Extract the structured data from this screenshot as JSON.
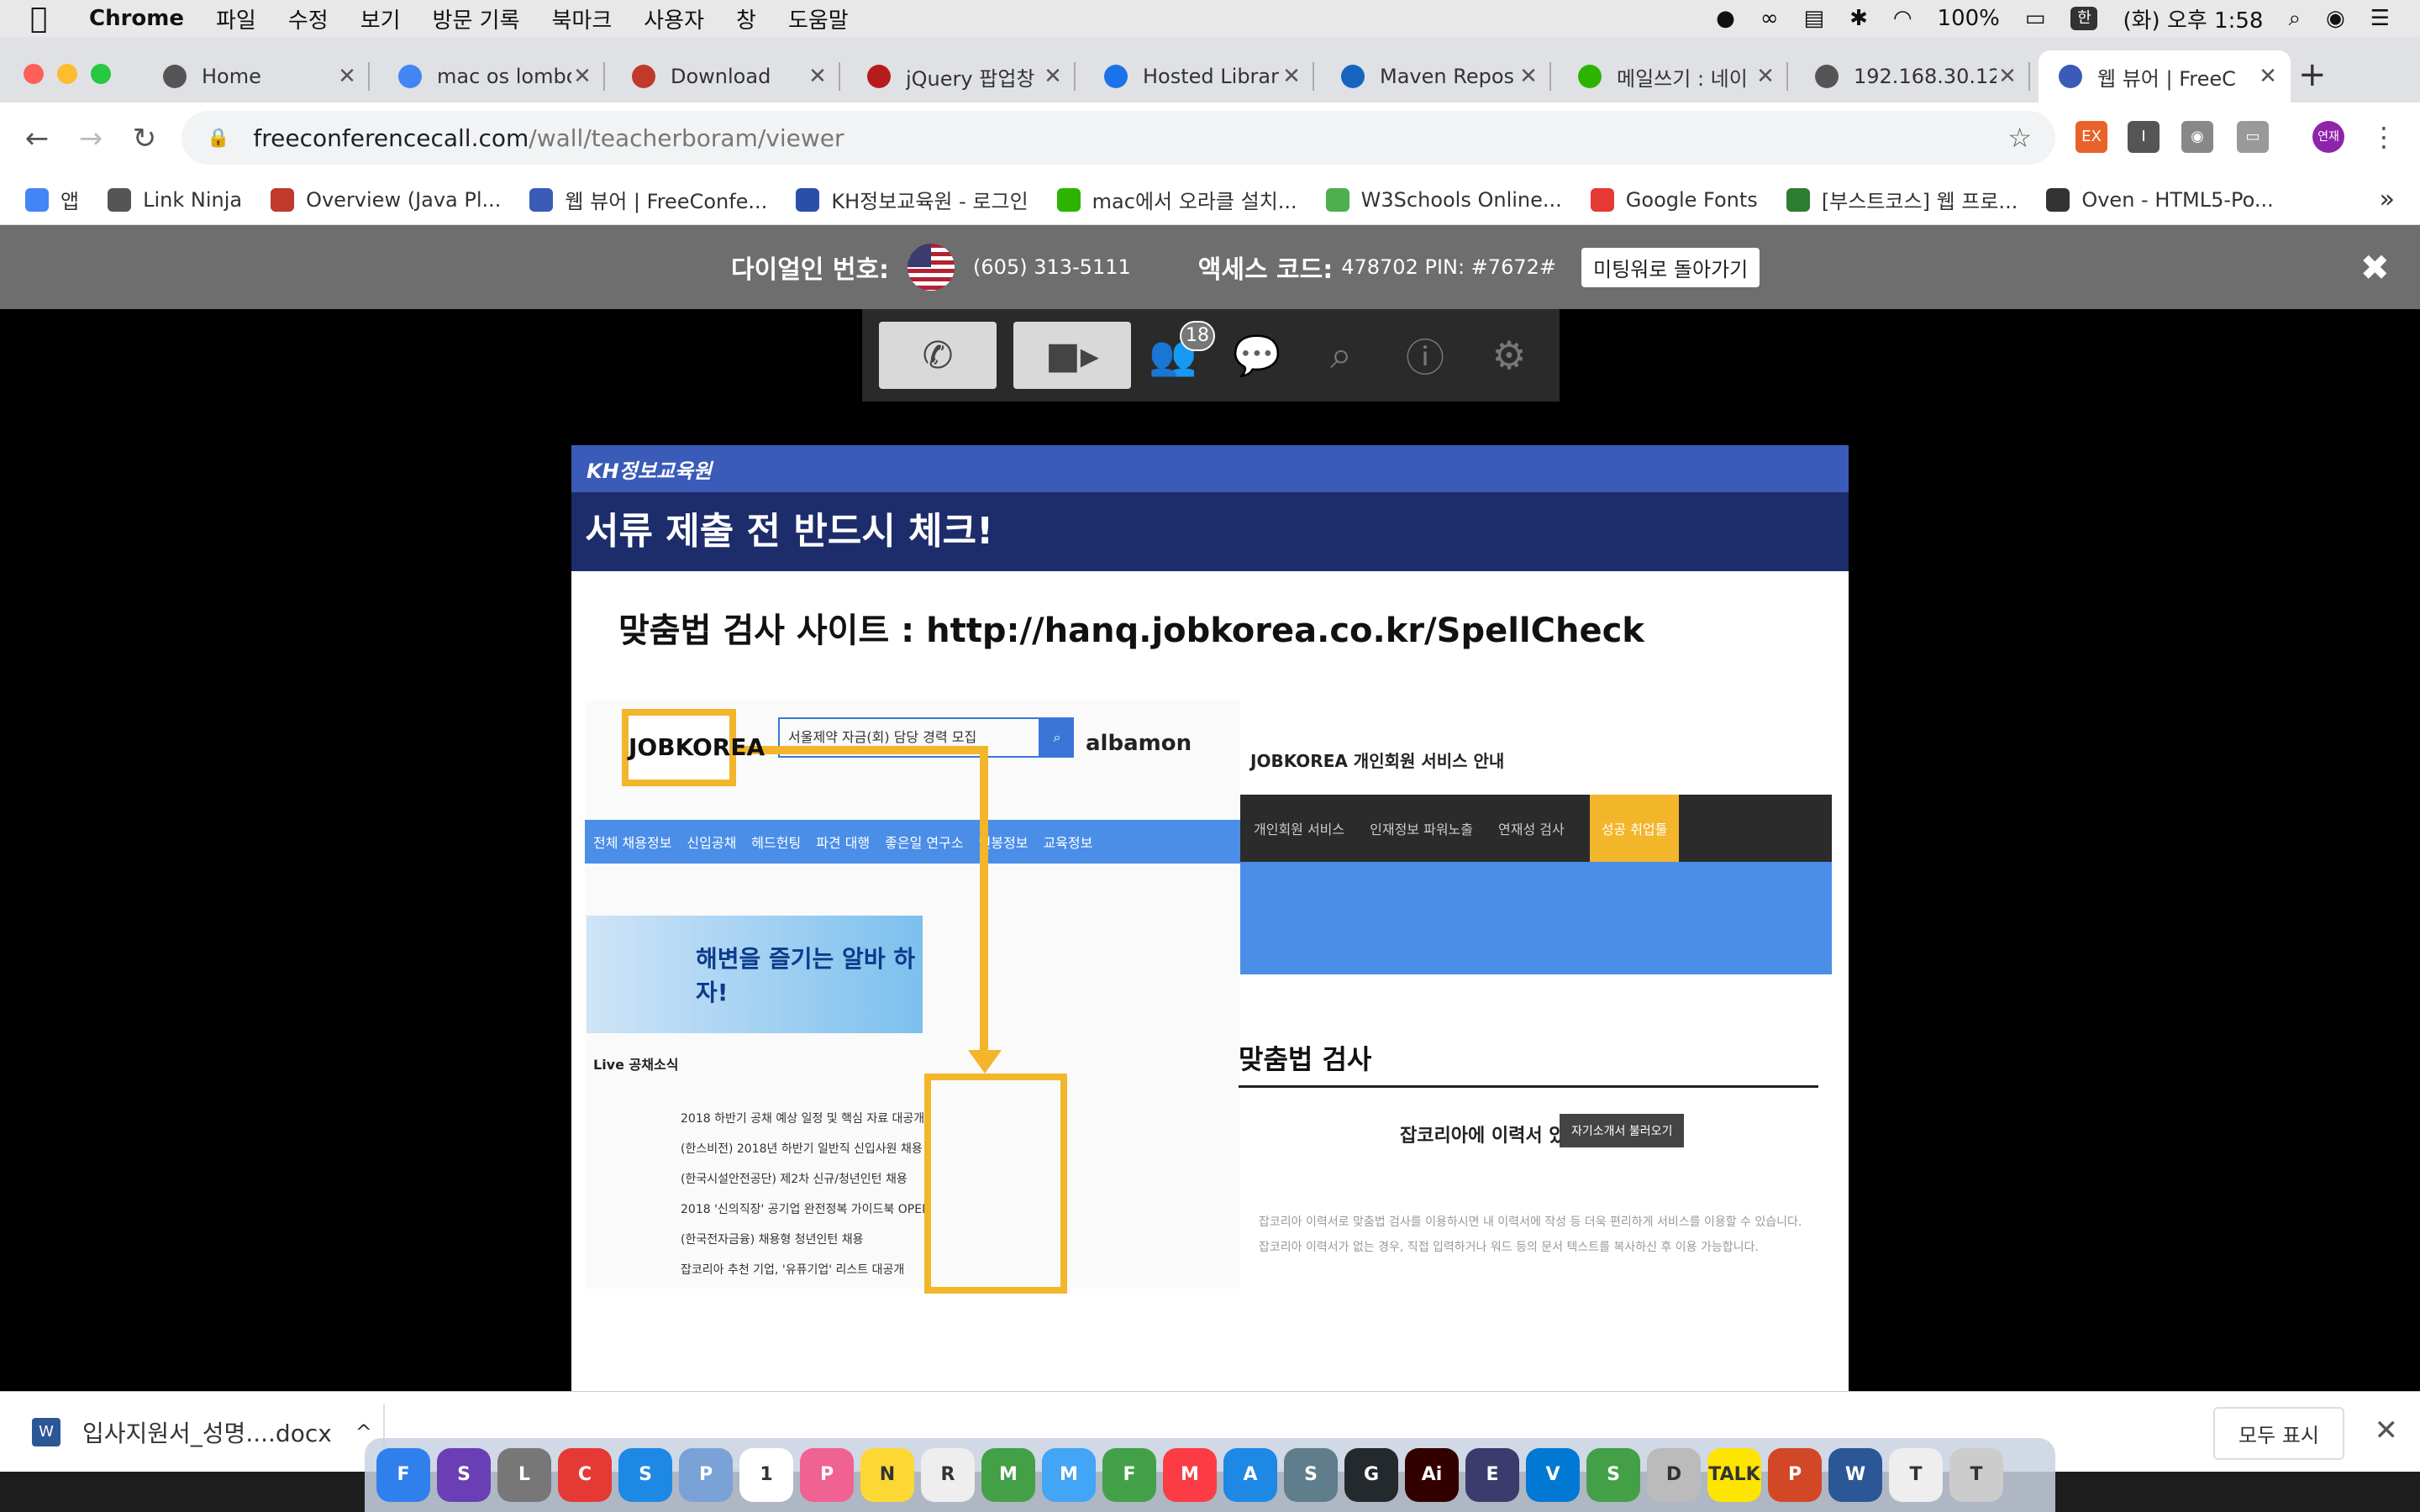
{
  "menubar": {
    "app": "Chrome",
    "items": [
      "파일",
      "수정",
      "보기",
      "방문 기록",
      "북마크",
      "사용자",
      "창",
      "도움말"
    ],
    "battery": "100%",
    "input_lang": "한",
    "clock": "(화) 오후 1:58"
  },
  "tabs": [
    {
      "label": "Home",
      "icon": "globe-icon",
      "color": "#555555"
    },
    {
      "label": "mac os lombo",
      "icon": "google-icon",
      "color": "#4285F4"
    },
    {
      "label": "Download",
      "icon": "java-icon",
      "color": "#c0392b"
    },
    {
      "label": "jQuery 팝업창",
      "icon": "feather-icon",
      "color": "#b71c1c"
    },
    {
      "label": "Hosted Librar",
      "icon": "code-icon",
      "color": "#1a73e8"
    },
    {
      "label": "Maven Repos",
      "icon": "mvn-icon",
      "color": "#1565c0"
    },
    {
      "label": "메일쓰기 : 네이",
      "icon": "mail-icon",
      "color": "#2db400"
    },
    {
      "label": "192.168.30.12",
      "icon": "globe-icon",
      "color": "#555555"
    },
    {
      "label": "웹 뷰어 | FreeC",
      "icon": "fcc-icon",
      "color": "#3a5bb8"
    }
  ],
  "address": {
    "domain": "freeconferencecall.com",
    "path": "/wall/teacherboram/viewer"
  },
  "extensions": [
    {
      "label": "EX",
      "color": "#e8622a"
    },
    {
      "label": "I",
      "color": "#555555"
    },
    {
      "label": "◉",
      "color": "#888888"
    },
    {
      "label": "▭",
      "color": "#999999"
    }
  ],
  "profile": "연재",
  "bookmarks": [
    {
      "label": "앱",
      "icon": "apps-icon",
      "color": "#4285F4"
    },
    {
      "label": "Link Ninja",
      "icon": "globe-icon",
      "color": "#555555"
    },
    {
      "label": "Overview (Java Pl...",
      "icon": "oracle-icon",
      "color": "#c0392b"
    },
    {
      "label": "웹 뷰어 | FreeConfe...",
      "icon": "fcc-icon",
      "color": "#3a5bb8"
    },
    {
      "label": "KH정보교육원 - 로그인",
      "icon": "kh-icon",
      "color": "#2a4fa8"
    },
    {
      "label": "mac에서 오라클 설치...",
      "icon": "blog-icon",
      "color": "#2db400"
    },
    {
      "label": "W3Schools Online...",
      "icon": "w3-icon",
      "color": "#4caf50"
    },
    {
      "label": "Google Fonts",
      "icon": "fonts-icon",
      "color": "#e53935"
    },
    {
      "label": "[부스트코스] 웹 프로...",
      "icon": "boost-icon",
      "color": "#2e7d32"
    },
    {
      "label": "Oven - HTML5-Po...",
      "icon": "oven-icon",
      "color": "#333333"
    }
  ],
  "conference": {
    "dialin_label": "다이얼인 번호:",
    "dialin_number": "(605) 313-5111",
    "access_label": "액세스 코드:",
    "access_value": "478702 PIN: #7672#",
    "back_button": "미팅워로 돌아가기",
    "participants": "18"
  },
  "slide": {
    "brand": "KH정보교육원",
    "heading": "서류 제출 전 반드시 체크!",
    "title": "맞춤법 검사 사이트 : http://hanq.jobkorea.co.kr/SpellCheck",
    "left": {
      "logo": "JOBKOREA",
      "search_text": "서울제약 자금(회) 담당 경력 모집",
      "albamon": "albamon",
      "nav": [
        "전체 채용정보",
        "신입공채",
        "헤드헌팅",
        "파견 대행",
        "좋은일 연구소",
        "연봉정보",
        "교육정보"
      ],
      "ad_text": "해변을 즐기는 알바 하자!",
      "live_title": "Live 공채소식",
      "news": [
        "2018 하반기 공채 예상 일정 및 핵심 자료 대공개",
        "(한스비전) 2018년 하반기 일반직 신입사원 채용",
        "(한국시설안전공단) 제2차 신규/청년인턴 채용",
        "2018 '신의직장' 공기업 완전정복 가이드북 OPEN",
        "(한국전자금융) 채용형 청년인턴 채용",
        "잡코리아 추천 기업, '유퓨기업' 리스트 대공개"
      ]
    },
    "right": {
      "header": "JOBKOREA 개인회원 서비스 안내",
      "tabs": [
        "개인회원 서비스",
        "인재정보 파워노출",
        "연재성 검사",
        "성공 취업툴"
      ],
      "spell_title": "맞춤법 검사",
      "question": "잡코리아에 이력서 있으시죠?",
      "question_btn": "자기소개서 불러오기",
      "note1": "잡코리아 이력서로 맞춤법 검사를 이용하시면 내 이력서에 작성 등 더욱 편리하게 서비스를 이용할 수 있습니다.",
      "note2": "잡코리아 이력서가 없는 경우, 직접 입력하거나 워드 등의 문서 텍스트를 복사하신 후 이용 가능합니다."
    }
  },
  "download": {
    "file": "입사지원서_성명....docx",
    "show_all": "모두 표시"
  },
  "dock": [
    {
      "label": "F",
      "color": "#2f80ed"
    },
    {
      "label": "S",
      "color": "#6a3fb5"
    },
    {
      "label": "L",
      "color": "#777777"
    },
    {
      "label": "C",
      "color": "#e53935"
    },
    {
      "label": "S",
      "color": "#1e88e5"
    },
    {
      "label": "P",
      "color": "#7aa2d6"
    },
    {
      "label": "1",
      "color": "#ffffff"
    },
    {
      "label": "P",
      "color": "#f06292"
    },
    {
      "label": "N",
      "color": "#fdd835"
    },
    {
      "label": "R",
      "color": "#eeeeee"
    },
    {
      "label": "M",
      "color": "#43a047"
    },
    {
      "label": "M",
      "color": "#42a5f5"
    },
    {
      "label": "F",
      "color": "#43a047"
    },
    {
      "label": "M",
      "color": "#fc3c44"
    },
    {
      "label": "A",
      "color": "#1e88e5"
    },
    {
      "label": "S",
      "color": "#607d8b"
    },
    {
      "label": "G",
      "color": "#24292e"
    },
    {
      "label": "Ai",
      "color": "#330000"
    },
    {
      "label": "E",
      "color": "#3b3b6d"
    },
    {
      "label": "V",
      "color": "#0078d4"
    },
    {
      "label": "S",
      "color": "#43a047"
    },
    {
      "label": "D",
      "color": "#bbbbbb"
    },
    {
      "label": "TALK",
      "color": "#fee500"
    },
    {
      "label": "P",
      "color": "#d24726"
    },
    {
      "label": "W",
      "color": "#2b5797"
    },
    {
      "label": "T",
      "color": "#eeeeee"
    },
    {
      "label": "T",
      "color": "#cccccc"
    }
  ]
}
